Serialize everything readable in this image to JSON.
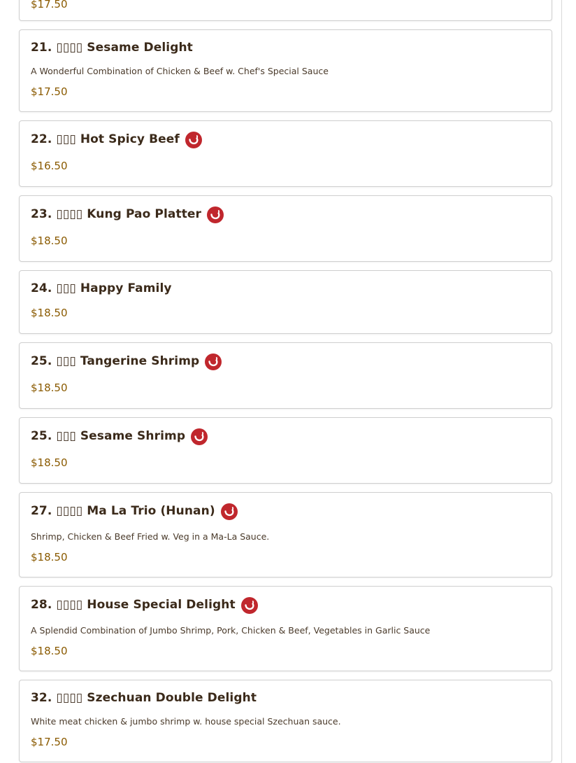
{
  "menu": {
    "partial_item": {
      "price": "$17.50"
    },
    "items": [
      {
        "title": "21. ▯▯▯▯ Sesame Delight",
        "description": "A Wonderful Combination of Chicken & Beef w. Chef's Special Sauce",
        "price": "$17.50",
        "spicy": false
      },
      {
        "title": "22. ▯▯▯ Hot Spicy Beef",
        "description": "",
        "price": "$16.50",
        "spicy": true
      },
      {
        "title": "23. ▯▯▯▯ Kung Pao Platter",
        "description": "",
        "price": "$18.50",
        "spicy": true
      },
      {
        "title": "24. ▯▯▯ Happy Family",
        "description": "",
        "price": "$18.50",
        "spicy": false
      },
      {
        "title": "25. ▯▯▯ Tangerine Shrimp",
        "description": "",
        "price": "$18.50",
        "spicy": true
      },
      {
        "title": "25. ▯▯▯ Sesame Shrimp",
        "description": "",
        "price": "$18.50",
        "spicy": true
      },
      {
        "title": "27. ▯▯▯▯ Ma La Trio (Hunan)",
        "description": "Shrimp, Chicken & Beef Fried w. Veg in a Ma-La Sauce.",
        "price": "$18.50",
        "spicy": true
      },
      {
        "title": "28. ▯▯▯▯ House Special Delight",
        "description": "A Splendid Combination of Jumbo Shrimp, Pork, Chicken & Beef, Vegetables in Garlic Sauce",
        "price": "$18.50",
        "spicy": true
      },
      {
        "title": "32. ▯▯▯▯ Szechuan Double Delight",
        "description": "White meat chicken & jumbo shrimp w. house special Szechuan sauce.",
        "price": "$17.50",
        "spicy": false
      }
    ]
  },
  "icons": {
    "spicy": "chili-pepper-icon"
  },
  "colors": {
    "title": "#3b2a1a",
    "price": "#8a5a00",
    "spicy_badge": "#c0272d",
    "card_border": "#cfcfcf"
  }
}
